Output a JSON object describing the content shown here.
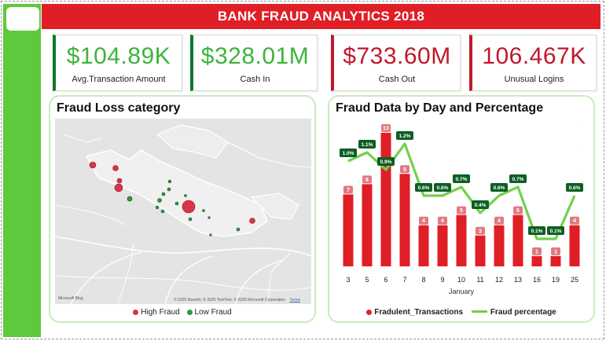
{
  "header": {
    "title": "BANK FRAUD ANALYTICS 2018"
  },
  "kpis": [
    {
      "value": "$104.89K",
      "label": "Avg.Transaction Amount",
      "tone": "green"
    },
    {
      "value": "$328.01M",
      "label": "Cash In",
      "tone": "green"
    },
    {
      "value": "$733.60M",
      "label": "Cash Out",
      "tone": "red"
    },
    {
      "value": "106.467K",
      "label": "Unusual Logins",
      "tone": "red"
    }
  ],
  "map_panel": {
    "title": "Fraud Loss category",
    "attribution": "© 2025 Navinfo, © 2025 TomTom, © 2025 Microsoft Corporation",
    "terms": "Terms",
    "logo": "Microsoft Bing",
    "legend": [
      {
        "label": "High Fraud",
        "color": "#d9344a"
      },
      {
        "label": "Low Fraud",
        "color": "#2e9a43"
      }
    ]
  },
  "chart_panel": {
    "title": "Fraud Data by Day and Percentage",
    "legend": {
      "bars": "Fradulent_Transactions",
      "line": "Fraud percentage"
    }
  },
  "colors": {
    "accent_red": "#e01e26",
    "accent_green": "#5fc93e",
    "line_green": "#6fd24a",
    "dark_green": "#0d5e22"
  },
  "chart_data": {
    "type": "bar",
    "categories": [
      "3",
      "5",
      "6",
      "7",
      "8",
      "9",
      "10",
      "11",
      "12",
      "13",
      "16",
      "19",
      "25"
    ],
    "xlabel": "January",
    "series": [
      {
        "name": "Fradulent_Transactions",
        "type": "bar",
        "values": [
          7,
          8,
          13,
          9,
          4,
          4,
          5,
          3,
          4,
          5,
          1,
          1,
          4
        ]
      },
      {
        "name": "Fraud percentage",
        "type": "line",
        "values": [
          1.0,
          1.1,
          0.9,
          1.2,
          0.6,
          0.6,
          0.7,
          0.4,
          0.6,
          0.7,
          0.1,
          0.1,
          0.6
        ],
        "labels": [
          "1.0%",
          "1.1%",
          "0.9%",
          "1.2%",
          "0.6%",
          "0.6%",
          "0.7%",
          "0.4%",
          "0.6%",
          "0.7%",
          "0.1%",
          "0.1%",
          "0.6%"
        ]
      }
    ],
    "ylim_bars": [
      0,
      13
    ],
    "ylim_line": [
      0,
      1.2
    ]
  }
}
